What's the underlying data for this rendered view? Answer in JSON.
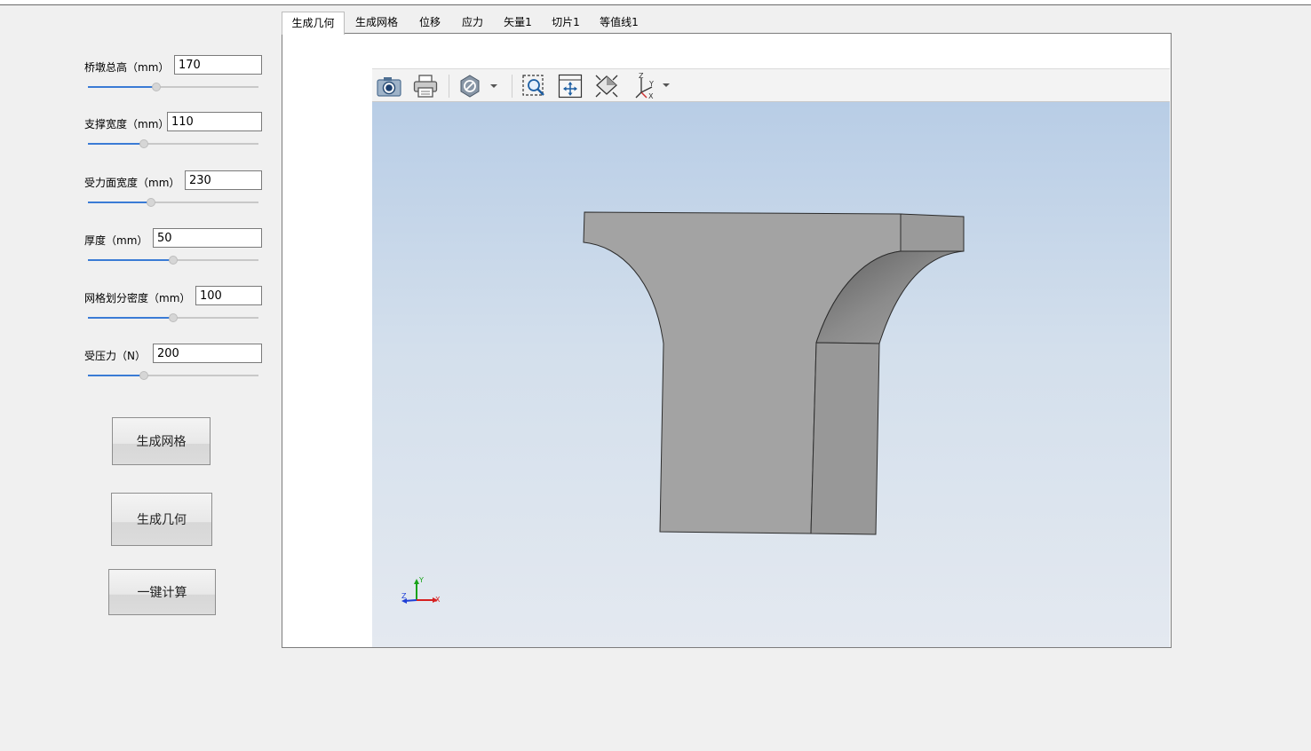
{
  "params": [
    {
      "label": "桥墩总高（mm）",
      "value": "170",
      "slider": 0.4
    },
    {
      "label": "支撑宽度（mm）",
      "value": "110",
      "slider": 0.33
    },
    {
      "label": "受力面宽度（mm）",
      "value": "230",
      "slider": 0.37
    },
    {
      "label": "厚度（mm）",
      "value": "50",
      "slider": 0.5
    },
    {
      "label": "网格划分密度（mm）",
      "value": "100",
      "slider": 0.5
    },
    {
      "label": "受压力（N）",
      "value": "200",
      "slider": 0.33
    }
  ],
  "buttons": {
    "mesh": "生成网格",
    "geometry": "生成几何",
    "compute": "一键计算"
  },
  "tabs": [
    "生成几何",
    "生成网格",
    "位移",
    "应力",
    "矢量1",
    "切片1",
    "等值线1"
  ],
  "active_tab": "生成几何",
  "toolbar_icons": [
    "camera-icon",
    "print-icon",
    "display-mode-icon",
    "zoom-box-icon",
    "fit-all-icon",
    "isometric-view-icon",
    "axes-view-icon"
  ],
  "triad": {
    "x": "X",
    "y": "Y",
    "z": "Z"
  },
  "view_cube_axes": {
    "x": "X",
    "y": "Y",
    "z": "Z"
  },
  "colors": {
    "slider_fill": "#3a7bd5",
    "model_face": "#a3a3a3",
    "background_top": "#b8cde6",
    "background_bottom": "#e4e9f0"
  }
}
